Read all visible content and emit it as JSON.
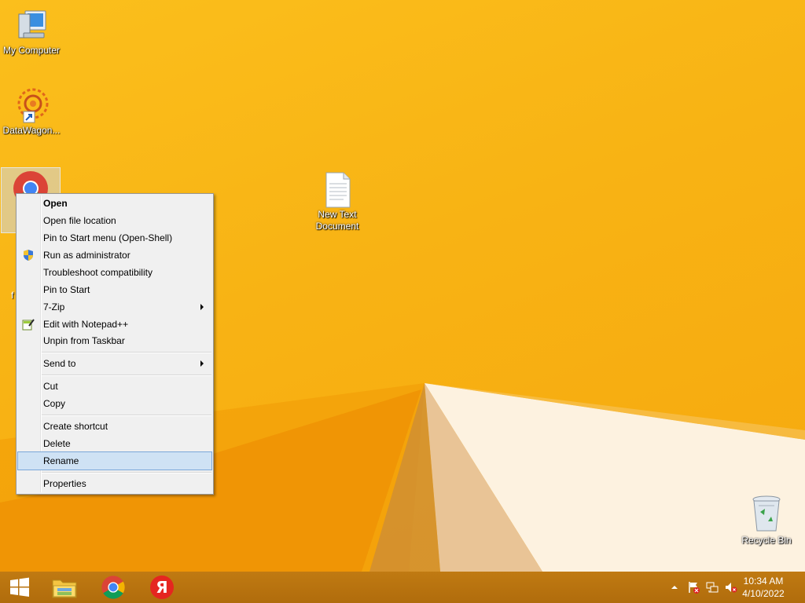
{
  "desktop": {
    "icons": {
      "my_computer": "My Computer",
      "datawagon": "DataWagon...",
      "new_text_doc_line1": "New Text",
      "new_text_doc_line2": "Document",
      "recycle_bin": "Recycle Bin"
    },
    "hidden_label_char": "f"
  },
  "context_menu": {
    "open": "Open",
    "open_file_location": "Open file location",
    "pin_start_menu": "Pin to Start menu (Open-Shell)",
    "run_as_admin": "Run as administrator",
    "troubleshoot": "Troubleshoot compatibility",
    "pin_to_start": "Pin to Start",
    "seven_zip": "7-Zip",
    "edit_notepad": "Edit with Notepad++",
    "unpin_taskbar": "Unpin from Taskbar",
    "send_to": "Send to",
    "cut": "Cut",
    "copy": "Copy",
    "create_shortcut": "Create shortcut",
    "delete": "Delete",
    "rename": "Rename",
    "properties": "Properties"
  },
  "taskbar": {
    "time": "10:34 AM",
    "date": "4/10/2022",
    "pinned": [
      "start-button",
      "file-explorer",
      "chrome",
      "yandex-browser"
    ],
    "yandex_letter": "Я"
  },
  "colors": {
    "desktop_bg": "#f8b314",
    "taskbar": "#b8700a",
    "menu_bg": "#f0f0f0",
    "menu_highlight": "#cfe2f4"
  }
}
